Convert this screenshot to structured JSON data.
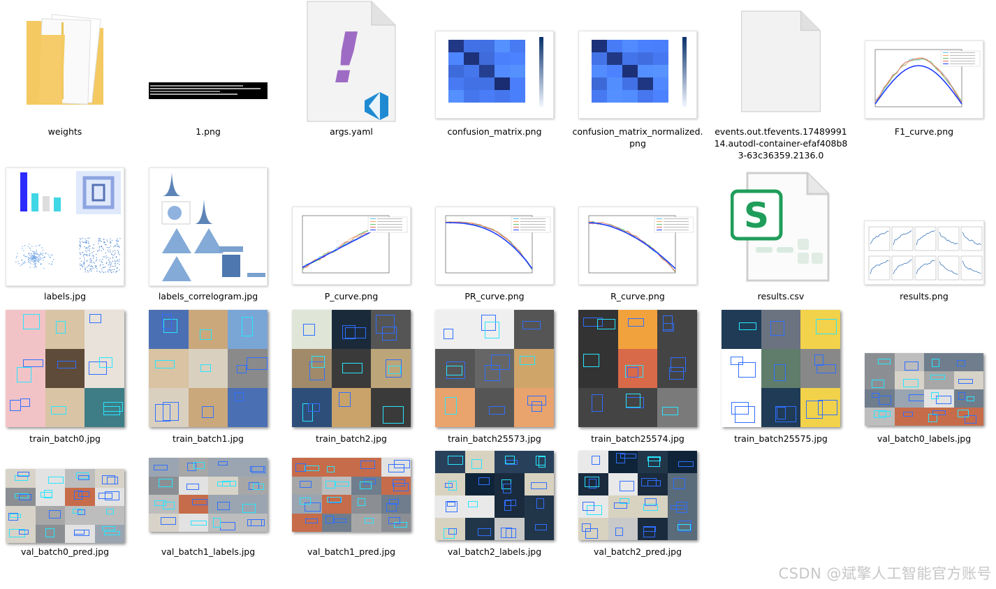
{
  "files": [
    {
      "name": "weights",
      "kind": "folder"
    },
    {
      "name": "1.png",
      "kind": "terminal"
    },
    {
      "name": "args.yaml",
      "kind": "yaml"
    },
    {
      "name": "confusion_matrix.png",
      "kind": "matrix"
    },
    {
      "name": "confusion_matrix_normalized.png",
      "kind": "matrix"
    },
    {
      "name": "events.out.tfevents.1748999114.autodl-container-efaf408b83-63c36359.2136.0",
      "kind": "blank"
    },
    {
      "name": "F1_curve.png",
      "kind": "curve"
    },
    {
      "name": "labels.jpg",
      "kind": "labels"
    },
    {
      "name": "labels_correlogram.jpg",
      "kind": "correlogram"
    },
    {
      "name": "P_curve.png",
      "kind": "curve"
    },
    {
      "name": "PR_curve.png",
      "kind": "curve"
    },
    {
      "name": "R_curve.png",
      "kind": "curve"
    },
    {
      "name": "results.csv",
      "kind": "csv"
    },
    {
      "name": "results.png",
      "kind": "results"
    },
    {
      "name": "train_batch0.jpg",
      "kind": "batch"
    },
    {
      "name": "train_batch1.jpg",
      "kind": "batch"
    },
    {
      "name": "train_batch2.jpg",
      "kind": "batch"
    },
    {
      "name": "train_batch25573.jpg",
      "kind": "batch"
    },
    {
      "name": "train_batch25574.jpg",
      "kind": "batch"
    },
    {
      "name": "train_batch25575.jpg",
      "kind": "batch"
    },
    {
      "name": "val_batch0_labels.jpg",
      "kind": "valbatch"
    },
    {
      "name": "val_batch0_pred.jpg",
      "kind": "valbatch"
    },
    {
      "name": "val_batch1_labels.jpg",
      "kind": "valbatch"
    },
    {
      "name": "val_batch1_pred.jpg",
      "kind": "valbatch"
    },
    {
      "name": "val_batch2_labels.jpg",
      "kind": "valbatch2"
    },
    {
      "name": "val_batch2_pred.jpg",
      "kind": "valbatch2"
    }
  ],
  "icons": {
    "folder": "folder-icon",
    "yaml_badge": "!",
    "csv_badge": "S",
    "vscode": "vscode-icon"
  },
  "colors": {
    "folder": "#f4c961",
    "yaml_mark": "#9e6bc4",
    "vscode_blue": "#1f8ad2",
    "csv_green": "#1f9d5a",
    "matrix_dark": "#08306b",
    "curve_blue": "#1f3cff",
    "label_bar": "#2b2bff",
    "label_bar2": "#3fd6e6"
  },
  "watermark": "CSDN @斌擎人工智能官方账号"
}
